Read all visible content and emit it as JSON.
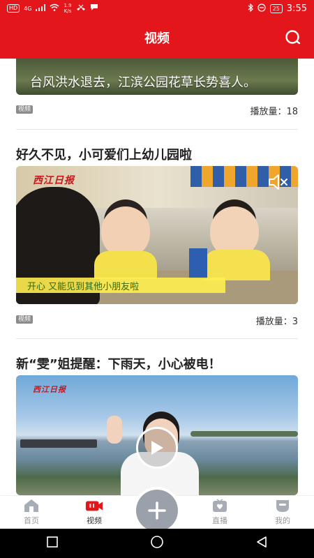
{
  "status_bar": {
    "left_badge": "HD",
    "network": "4G",
    "speed_value": "1.9",
    "speed_unit": "K/s",
    "battery": "25",
    "time": "3:55"
  },
  "header": {
    "title": "视频",
    "icons": {
      "search": "search-icon"
    }
  },
  "feed": {
    "items": [
      {
        "thumbnail_caption": "台风洪水退去，江滨公园花草长势喜人。",
        "tag": "视频",
        "plays": "播放量：18"
      },
      {
        "title": "好久不见，小可爱们上幼儿园啦",
        "logo": "西江日报",
        "subtitle": "开心 又能见到其他小朋友啦",
        "tag": "视频",
        "plays": "播放量：3"
      },
      {
        "title": "新“雯”姐提醒：下雨天，小心被电！",
        "logo": "西江日报"
      }
    ]
  },
  "bottom_nav": {
    "items": [
      {
        "label": "首页",
        "icon": "home-icon"
      },
      {
        "label": "视频",
        "icon": "video-icon",
        "active": true
      },
      {
        "label": "直播",
        "icon": "live-icon"
      },
      {
        "label": "我的",
        "icon": "profile-icon"
      }
    ],
    "plus_icon": "plus-icon"
  },
  "colors": {
    "brand": "#e3161c",
    "tag_bg": "#8b8b8b",
    "nav_inactive": "#999999"
  }
}
